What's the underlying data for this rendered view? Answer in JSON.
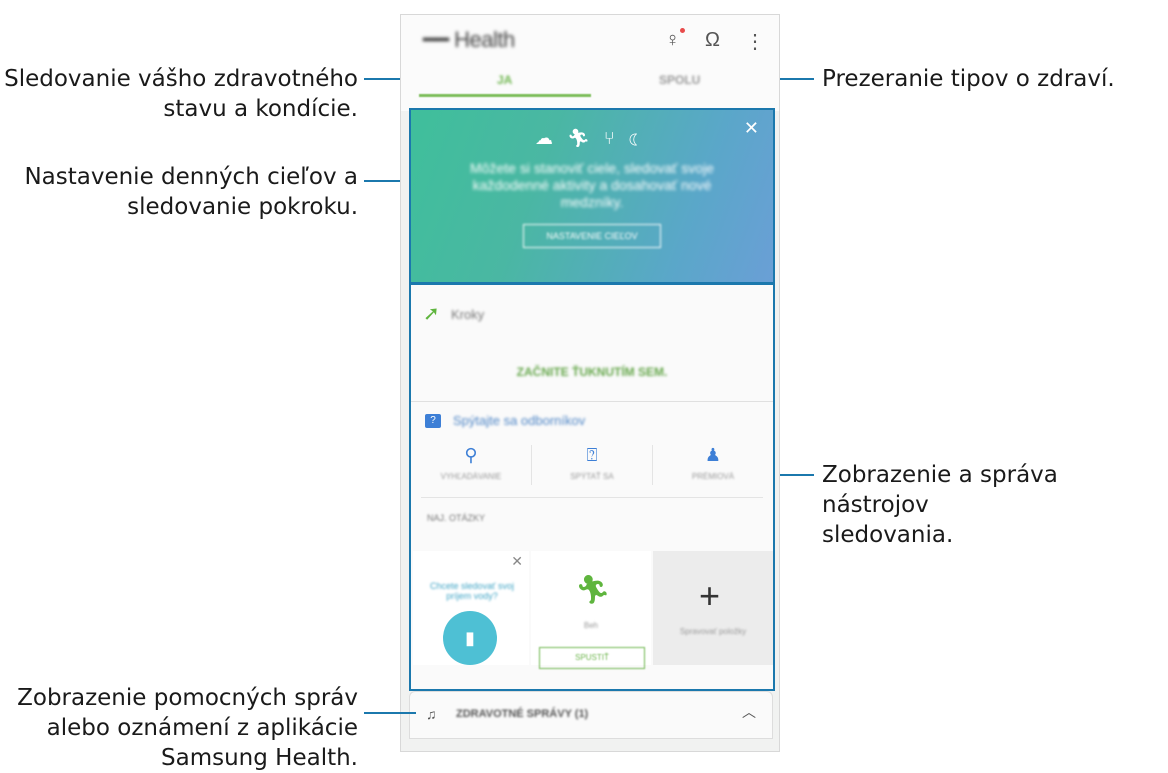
{
  "annotations": {
    "left": [
      "Sledovanie vášho zdravotného\nstavu a kondície.",
      "Nastavenie denných cieľov a\nsledovanie pokroku.",
      "Zobrazenie pomocných správ\nalebo oznámení z aplikácie\nSamsung Health."
    ],
    "right": [
      "Prezeranie tipov o zdraví.",
      "Zobrazenie a správa nástrojov\nsledovania."
    ]
  },
  "app": {
    "title": "Health",
    "tabs": [
      "JA",
      "SPOLU"
    ]
  },
  "banner": {
    "icons": [
      "heart-icon",
      "run-icon",
      "food-icon",
      "moon-icon"
    ],
    "text": "Môžete si stanoviť ciele, sledovať svoje každodenné aktivity a dosahovať nové medzníky.",
    "button": "NASTAVENIE CIEĽOV"
  },
  "steps": {
    "title": "Kroky",
    "action": "ZAČNITE ŤUKNUTÍM SEM."
  },
  "experts": {
    "title": "Spýtajte sa odborníkov",
    "services": [
      "VYHĽADÁVANIE",
      "SPÝTAŤ SA",
      "PRÉMIOVÁ"
    ],
    "faq": "NAJ. OTÁZKY"
  },
  "cards": {
    "water_question": "Chcete sledovať svoj príjem vody?",
    "run_label": "Beh",
    "run_button": "SPUSTIŤ",
    "manage_label": "Spravovať položky"
  },
  "notifications": {
    "label": "ZDRAVOTNÉ SPRÁVY (1)"
  },
  "colors": {
    "callout_line": "#1b78ad",
    "accent_green": "#6fb64f"
  }
}
